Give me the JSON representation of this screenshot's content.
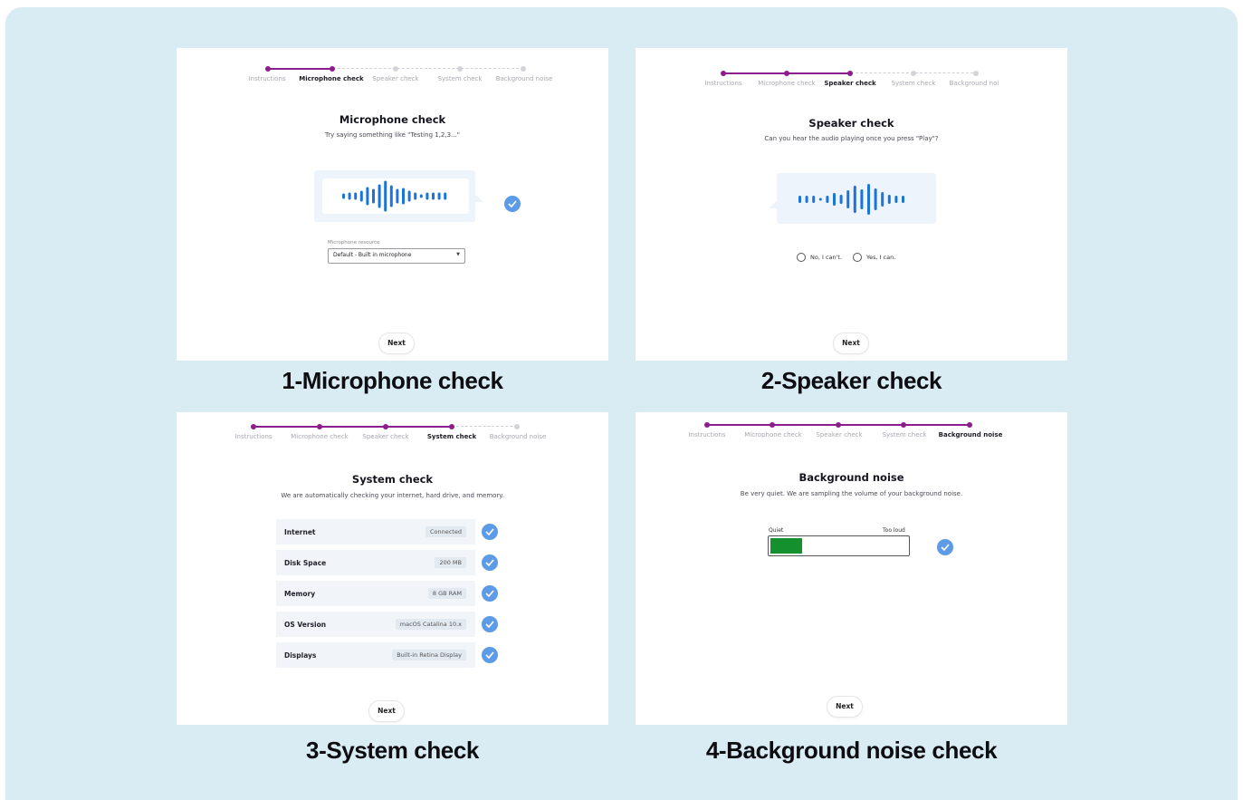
{
  "steps": [
    "Instructions",
    "Microphone check",
    "Speaker check",
    "System check",
    "Background noise"
  ],
  "steps_truncated_last": "Background noi",
  "panel1": {
    "title": "Microphone check",
    "subtitle": "Try saying something like \"Testing 1,2,3...\"",
    "field_label": "Microphone resource",
    "select_value": "Default - Built in microphone",
    "next": "Next",
    "caption": "1-Microphone check"
  },
  "panel2": {
    "title": "Speaker check",
    "subtitle": "Can you hear the audio playing once you press \"Play\"?",
    "option_no": "No, I can't.",
    "option_yes": "Yes, I can.",
    "next": "Next",
    "caption": "2-Speaker check"
  },
  "panel3": {
    "title": "System check",
    "subtitle": "We are automatically checking your internet, hard drive, and memory.",
    "rows": [
      {
        "key": "Internet",
        "value": "Connected"
      },
      {
        "key": "Disk Space",
        "value": "200 MB"
      },
      {
        "key": "Memory",
        "value": "8 GB RAM"
      },
      {
        "key": "OS Version",
        "value": "macOS Catalina 10.x"
      },
      {
        "key": "Displays",
        "value": "Built-in Retina Display"
      }
    ],
    "next": "Next",
    "caption": "3-System check"
  },
  "panel4": {
    "title": "Background noise",
    "subtitle": "Be very quiet. We are sampling the volume of your background noise.",
    "meter_low": "Quiet",
    "meter_high": "Too loud",
    "meter_level": 0.23,
    "next": "Next",
    "caption": "4-Background noise check"
  },
  "colors": {
    "background": "#d9ecf3",
    "progress": "#8c1d8c",
    "wave": "#1d74d6",
    "check": "#5d9be6",
    "meter": "#14912e"
  },
  "icons": [
    "check-icon",
    "waveform-icon",
    "chevron-down-icon"
  ]
}
